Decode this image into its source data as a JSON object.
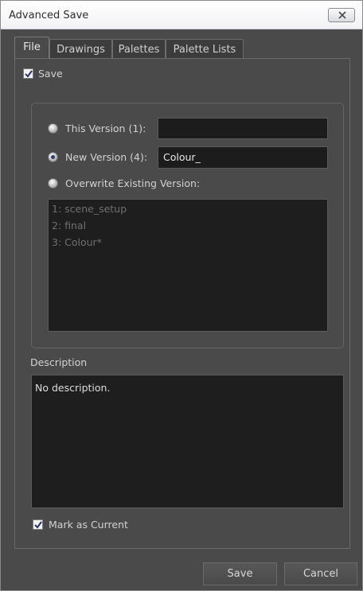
{
  "window": {
    "title": "Advanced Save"
  },
  "icons": {
    "close": "close-icon",
    "check": "checkmark-icon"
  },
  "tabs": [
    {
      "label": "File",
      "active": true
    },
    {
      "label": "Drawings",
      "active": false
    },
    {
      "label": "Palettes",
      "active": false
    },
    {
      "label": "Palette Lists",
      "active": false
    }
  ],
  "file_tab": {
    "save_checkbox": {
      "label": "Save",
      "checked": true
    },
    "version_options": [
      {
        "label": "This Version (1):",
        "selected": false,
        "field_value": ""
      },
      {
        "label": "New Version (4):",
        "selected": true,
        "field_value": "Colour_"
      },
      {
        "label": "Overwrite Existing Version:",
        "selected": false
      }
    ],
    "existing_versions": [
      "1: scene_setup",
      "2: final",
      "3: Colour*"
    ],
    "description": {
      "label": "Description",
      "value": "No description."
    },
    "mark_as_current": {
      "label": "Mark as Current",
      "checked": true
    }
  },
  "buttons": {
    "save": "Save",
    "cancel": "Cancel"
  },
  "colors": {
    "background": "#4a4a4a",
    "field_background": "#1e1e1e",
    "radio_dot": "#2e3f6a"
  }
}
